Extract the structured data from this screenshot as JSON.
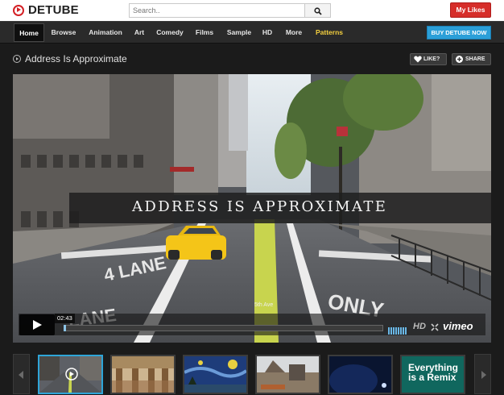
{
  "header": {
    "logo_text": "DETUBE",
    "search_placeholder": "Search..",
    "my_likes_label": "My Likes"
  },
  "nav": {
    "items": [
      {
        "label": "Home",
        "active": true
      },
      {
        "label": "Browse"
      },
      {
        "label": "Animation"
      },
      {
        "label": "Art"
      },
      {
        "label": "Comedy"
      },
      {
        "label": "Films"
      },
      {
        "label": "Sample"
      },
      {
        "label": "HD"
      },
      {
        "label": "More"
      },
      {
        "label": "Patterns",
        "accent": true
      }
    ],
    "buy_label": "BUY DETUBE NOW"
  },
  "video": {
    "title": "Address Is Approximate",
    "like_label": "LIKE?",
    "share_label": "SHARE",
    "caption": "ADDRESS IS APPROXIMATE",
    "timecode": "02:43",
    "hd_label": "HD",
    "provider": "vimeo"
  },
  "thumbnails": {
    "items": [
      {
        "label": ""
      },
      {
        "label": ""
      },
      {
        "label": ""
      },
      {
        "label": ""
      },
      {
        "label": ""
      },
      {
        "label": "Everything is a Remix"
      }
    ],
    "remix_line1": "Everything",
    "remix_line2": "is a Remix"
  },
  "colors": {
    "brand_red": "#d42025",
    "my_likes_red": "#d62e2a",
    "buy_blue": "#2b9fd8",
    "accent_yellow": "#f4d03f",
    "selected_border": "#2ea5d8"
  },
  "icons": {
    "logo": "play-circle-icon",
    "search": "search-icon",
    "like": "heart-icon",
    "share": "plus-circle-icon",
    "play": "play-icon",
    "fullscreen": "fullscreen-icon"
  }
}
